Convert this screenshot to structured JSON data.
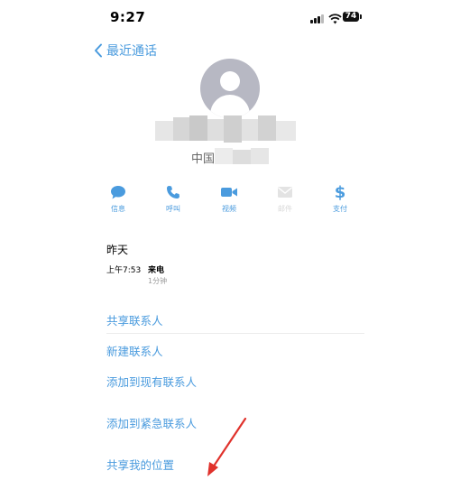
{
  "status": {
    "time": "9:27",
    "battery": "74"
  },
  "nav": {
    "back_label": "最近通话"
  },
  "contact": {
    "subtitle": "中国"
  },
  "actions": [
    {
      "label": "信息"
    },
    {
      "label": "呼叫"
    },
    {
      "label": "视频"
    },
    {
      "label": "邮件"
    },
    {
      "label": "支付"
    }
  ],
  "history": {
    "day": "昨天",
    "time": "上午7:53",
    "type": "来电",
    "duration": "1分钟"
  },
  "links": [
    {
      "label": "共享联系人"
    },
    {
      "label": "新建联系人"
    },
    {
      "label": "添加到现有联系人"
    },
    {
      "label": "添加到紧急联系人"
    },
    {
      "label": "共享我的位置"
    }
  ],
  "colors": {
    "accent": "#4a9bde",
    "avatar": "#b7b8c3",
    "annotation": "#e0322c"
  }
}
